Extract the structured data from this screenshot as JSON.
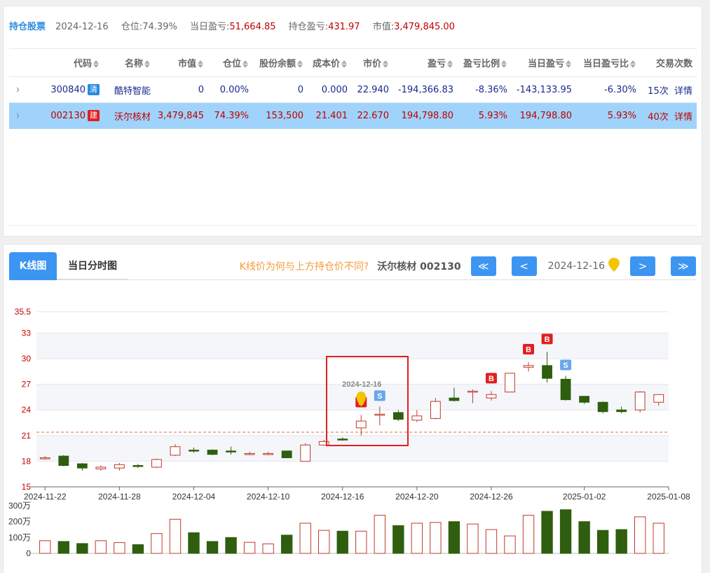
{
  "summary": {
    "title": "持仓股票",
    "date": "2024-12-16",
    "position_label": "仓位:",
    "position_value": "74.39%",
    "day_pnl_label": "当日盈亏:",
    "day_pnl_value": "51,664.85",
    "hold_pnl_label": "持仓盈亏:",
    "hold_pnl_value": "431.97",
    "market_value_label": "市值:",
    "market_value_value": "3,479,845.00"
  },
  "table": {
    "headers": [
      "代码",
      "名称",
      "市值",
      "仓位",
      "股份余额",
      "成本价",
      "市价",
      "盈亏",
      "盈亏比例",
      "当日盈亏",
      "当日盈亏比",
      "交易次数"
    ],
    "rows": [
      {
        "code": "300840",
        "badge": "清",
        "name": "酷特智能",
        "mv": "0",
        "pos": "0.00%",
        "shares": "0",
        "cost": "0.000",
        "price": "22.940",
        "pnl": "-194,366.83",
        "pnl_pct": "-8.36%",
        "day_pnl": "-143,133.95",
        "day_pct": "-6.30%",
        "trades": "15次",
        "detail": "详情"
      },
      {
        "code": "002130",
        "badge": "建",
        "name": "沃尔核材",
        "mv": "3,479,845",
        "pos": "74.39%",
        "shares": "153,500",
        "cost": "21.401",
        "price": "22.670",
        "pnl": "194,798.80",
        "pnl_pct": "5.93%",
        "day_pnl": "194,798.80",
        "day_pct": "5.93%",
        "trades": "40次",
        "detail": "详情"
      }
    ]
  },
  "tabs": {
    "kline": "K线图",
    "intraday": "当日分时图"
  },
  "chart_nav": {
    "why_link": "K线价为何与上方持仓价不同?",
    "stock": "沃尔核材 002130",
    "first": "≪",
    "prev": "<",
    "next": ">",
    "last": "≫",
    "date": "2024-12-16"
  },
  "colors": {
    "accent": "#3d95f2",
    "up": "#c0392b",
    "down": "#2e5e0e",
    "highlight_row": "#9fd3fb"
  },
  "chart_data": {
    "type": "candlestick",
    "price_ticks": [
      "35.5",
      "33",
      "30",
      "27",
      "24",
      "21",
      "18",
      "15"
    ],
    "ylim": [
      15,
      35.5
    ],
    "x_ticks": [
      "2024-11-22",
      "2024-11-28",
      "2024-12-04",
      "2024-12-10",
      "2024-12-16",
      "2024-12-20",
      "2024-12-26",
      "2025-01-02",
      "2025-01-08"
    ],
    "volume_ticks": [
      "300万",
      "200万",
      "100万",
      "0"
    ],
    "cost_line": 21.4,
    "highlight_label": "2024-12-16",
    "candles": [
      {
        "o": 18.4,
        "c": 18.4,
        "h": 18.6,
        "l": 18.2,
        "v": 80
      },
      {
        "o": 18.6,
        "c": 17.5,
        "h": 18.7,
        "l": 17.4,
        "v": 75
      },
      {
        "o": 17.7,
        "c": 17.2,
        "h": 17.8,
        "l": 16.9,
        "v": 62
      },
      {
        "o": 17.1,
        "c": 17.3,
        "h": 17.5,
        "l": 16.9,
        "v": 80
      },
      {
        "o": 17.2,
        "c": 17.6,
        "h": 17.8,
        "l": 16.9,
        "v": 68
      },
      {
        "o": 17.5,
        "c": 17.4,
        "h": 17.7,
        "l": 17.2,
        "v": 55
      },
      {
        "o": 17.3,
        "c": 18.2,
        "h": 18.3,
        "l": 17.2,
        "v": 125
      },
      {
        "o": 18.7,
        "c": 19.7,
        "h": 20.0,
        "l": 18.6,
        "v": 215
      },
      {
        "o": 19.3,
        "c": 19.2,
        "h": 19.6,
        "l": 19.0,
        "v": 130
      },
      {
        "o": 19.3,
        "c": 18.8,
        "h": 19.4,
        "l": 18.7,
        "v": 75
      },
      {
        "o": 19.2,
        "c": 19.1,
        "h": 19.7,
        "l": 18.8,
        "v": 100
      },
      {
        "o": 18.8,
        "c": 18.9,
        "h": 19.1,
        "l": 18.7,
        "v": 70
      },
      {
        "o": 18.8,
        "c": 18.9,
        "h": 19.1,
        "l": 18.7,
        "v": 60
      },
      {
        "o": 19.2,
        "c": 18.4,
        "h": 19.2,
        "l": 18.4,
        "v": 115
      },
      {
        "o": 18.0,
        "c": 19.9,
        "h": 20.1,
        "l": 18.0,
        "v": 190
      },
      {
        "o": 19.9,
        "c": 20.3,
        "h": 20.5,
        "l": 19.8,
        "v": 145
      },
      {
        "o": 20.6,
        "c": 20.5,
        "h": 20.8,
        "l": 20.4,
        "v": 140
      },
      {
        "o": 21.9,
        "c": 22.7,
        "h": 23.4,
        "l": 21.0,
        "v": 140,
        "mark": "B"
      },
      {
        "o": 23.5,
        "c": 23.5,
        "h": 24.4,
        "l": 22.2,
        "v": 240,
        "mark": "S"
      },
      {
        "o": 23.7,
        "c": 22.9,
        "h": 24.0,
        "l": 22.7,
        "v": 175
      },
      {
        "o": 22.8,
        "c": 23.3,
        "h": 24.0,
        "l": 22.6,
        "v": 190
      },
      {
        "o": 23.0,
        "c": 25.0,
        "h": 25.4,
        "l": 22.9,
        "v": 195
      },
      {
        "o": 25.4,
        "c": 25.1,
        "h": 26.6,
        "l": 25.0,
        "v": 200
      },
      {
        "o": 26.2,
        "c": 26.2,
        "h": 26.4,
        "l": 24.8,
        "v": 185
      },
      {
        "o": 25.4,
        "c": 25.8,
        "h": 26.2,
        "l": 25.1,
        "v": 150,
        "mark": "B"
      },
      {
        "o": 26.1,
        "c": 28.3,
        "h": 28.3,
        "l": 26.1,
        "v": 110
      },
      {
        "o": 29.0,
        "c": 29.2,
        "h": 29.6,
        "l": 28.5,
        "v": 240,
        "mark": "B"
      },
      {
        "o": 29.2,
        "c": 27.7,
        "h": 30.8,
        "l": 27.2,
        "v": 265,
        "mark": "B"
      },
      {
        "o": 27.6,
        "c": 25.2,
        "h": 28.0,
        "l": 25.1,
        "v": 275,
        "mark": "S"
      },
      {
        "o": 25.6,
        "c": 24.9,
        "h": 25.6,
        "l": 24.7,
        "v": 200
      },
      {
        "o": 24.9,
        "c": 23.8,
        "h": 25.0,
        "l": 23.6,
        "v": 145
      },
      {
        "o": 24.0,
        "c": 23.8,
        "h": 24.4,
        "l": 23.6,
        "v": 150
      },
      {
        "o": 24.0,
        "c": 26.1,
        "h": 26.2,
        "l": 23.7,
        "v": 230
      },
      {
        "o": 24.9,
        "c": 25.8,
        "h": 25.8,
        "l": 24.5,
        "v": 190
      }
    ]
  }
}
